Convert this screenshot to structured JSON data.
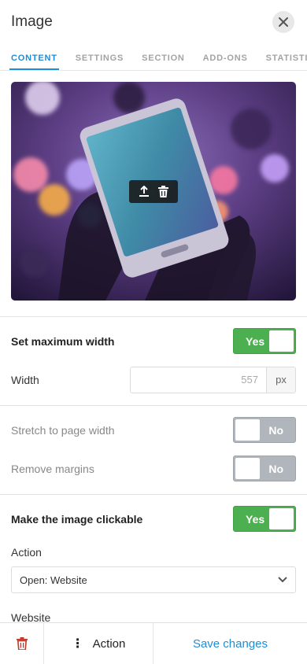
{
  "header": {
    "title": "Image"
  },
  "tabs": [
    {
      "label": "CONTENT",
      "active": true
    },
    {
      "label": "SETTINGS",
      "active": false
    },
    {
      "label": "SECTION",
      "active": false
    },
    {
      "label": "ADD-ONS",
      "active": false
    },
    {
      "label": "STATISTICS",
      "active": false
    }
  ],
  "image_toolbar": {
    "icons": [
      "upload-icon",
      "trash-icon"
    ]
  },
  "settings": {
    "max_width": {
      "label": "Set maximum width",
      "toggle": "Yes",
      "on": true
    },
    "width": {
      "label": "Width",
      "value": "557",
      "unit": "px"
    },
    "stretch": {
      "label": "Stretch to page width",
      "toggle": "No",
      "on": false
    },
    "margins": {
      "label": "Remove margins",
      "toggle": "No",
      "on": false
    },
    "clickable": {
      "label": "Make the image clickable",
      "toggle": "Yes",
      "on": true
    },
    "action": {
      "label": "Action",
      "value": "Open: Website"
    },
    "website": {
      "label": "Website"
    }
  },
  "bottom_bar": {
    "action_label": "Action",
    "save_label": "Save changes"
  },
  "colors": {
    "accent": "#1f8dd6",
    "toggle_on": "#4caf50",
    "toggle_off": "#b0b6bb",
    "delete": "#c0392b"
  }
}
